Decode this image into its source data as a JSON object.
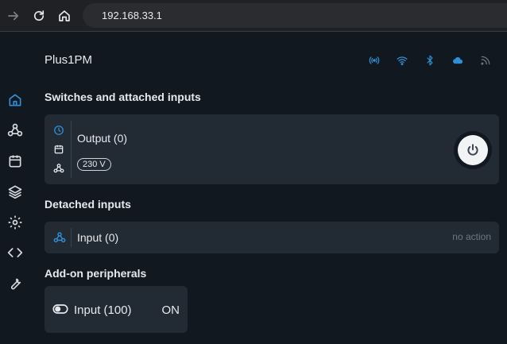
{
  "browser": {
    "url": "192.168.33.1",
    "icons": {
      "forward": "forward-arrow-icon",
      "reload": "reload-icon",
      "home": "home-icon"
    }
  },
  "sidebar": {
    "items": [
      {
        "id": "home",
        "icon": "home-icon",
        "active": true
      },
      {
        "id": "webhooks",
        "icon": "webhook-icon"
      },
      {
        "id": "schedules",
        "icon": "calendar-icon"
      },
      {
        "id": "components",
        "icon": "layers-icon"
      },
      {
        "id": "settings",
        "icon": "gear-icon"
      },
      {
        "id": "scripts",
        "icon": "code-icon"
      },
      {
        "id": "tools",
        "icon": "wrench-icon"
      }
    ]
  },
  "header": {
    "device_name": "Plus1PM",
    "status_icons": [
      "broadcast-icon",
      "wifi-icon",
      "bluetooth-icon",
      "cloud-icon",
      "rss-icon"
    ]
  },
  "sections": {
    "switches_title": "Switches and attached inputs",
    "detached_title": "Detached inputs",
    "addon_title": "Add-on peripherals"
  },
  "output": {
    "label": "Output (0)",
    "voltage": "230 V",
    "icons": [
      "clock-icon",
      "calendar-icon",
      "webhook-icon"
    ],
    "state": "off"
  },
  "detached_input": {
    "label": "Input (0)",
    "action": "no action"
  },
  "addon_input": {
    "label": "Input (100)",
    "state": "ON"
  },
  "colors": {
    "background": "#111820",
    "card": "#222a33",
    "accent": "#2f8fd6",
    "text": "#e6e9ed",
    "muted": "#6d7782"
  }
}
